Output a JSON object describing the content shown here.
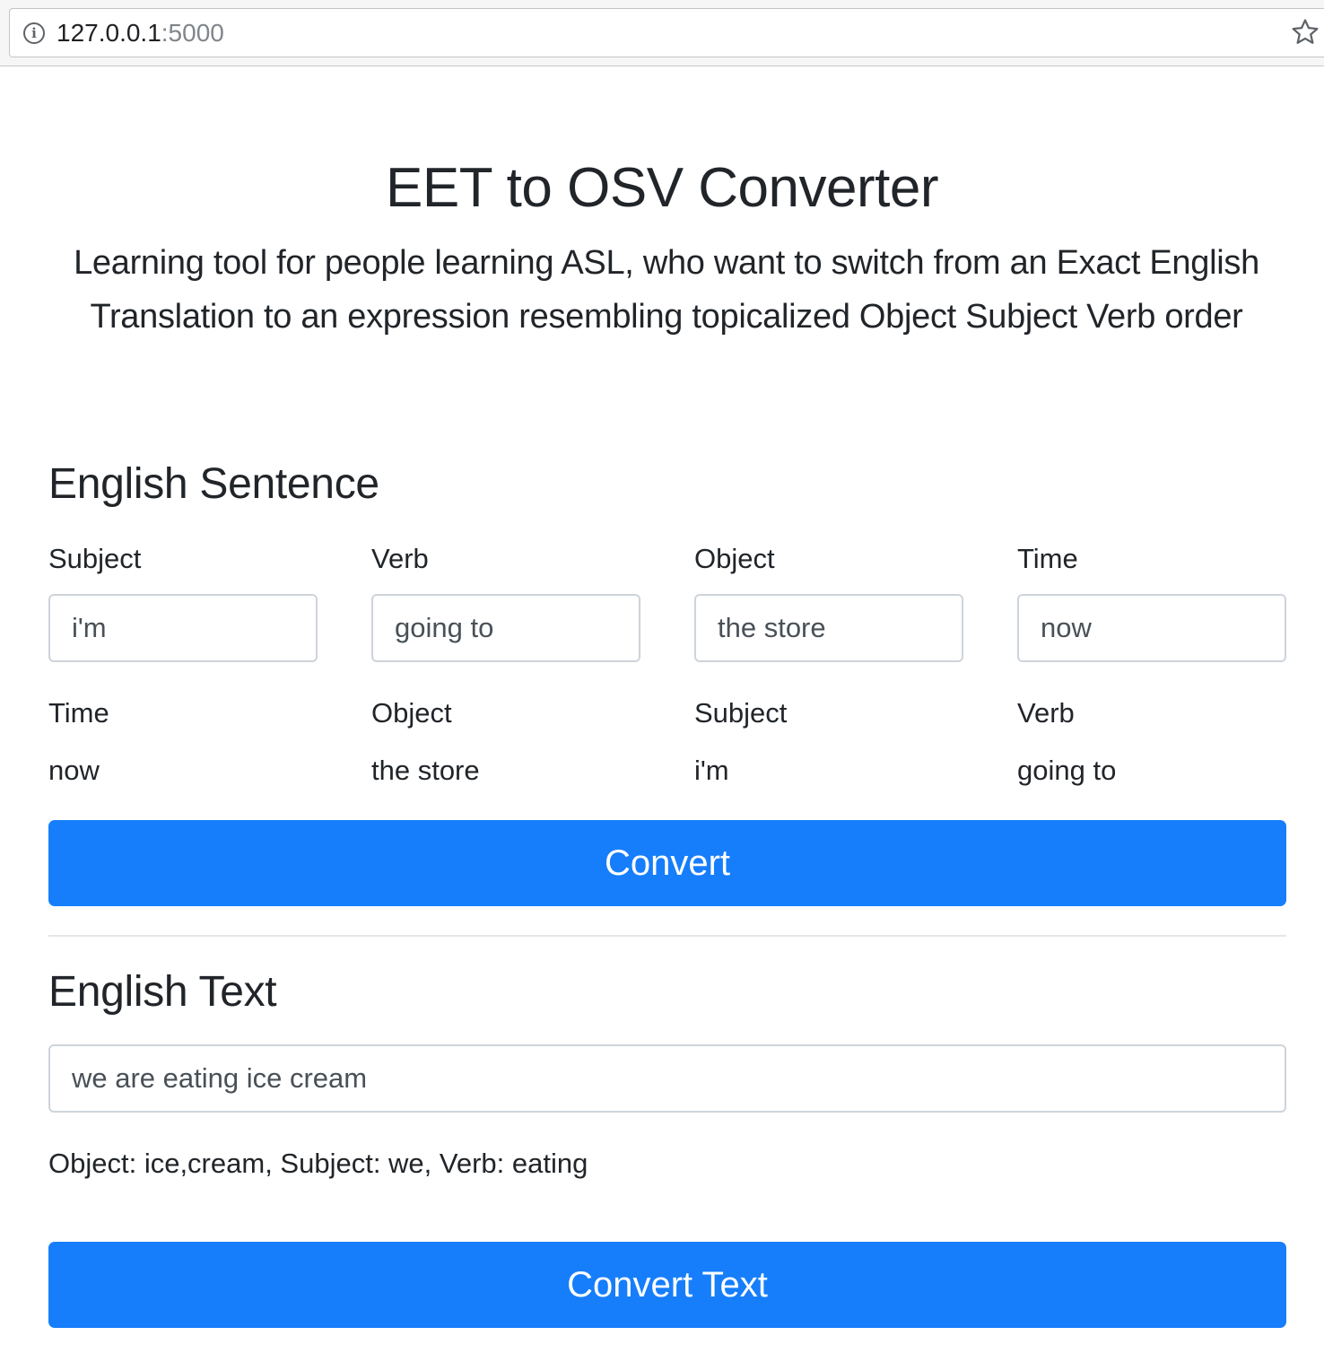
{
  "browser": {
    "url_host": "127.0.0.1",
    "url_port": ":5000"
  },
  "header": {
    "title": "EET to OSV Converter",
    "lead": "Learning tool for people learning ASL, who want to switch from an Exact English Translation to an expression resembling topicalized Object Subject Verb order"
  },
  "sentence_section": {
    "heading": "English Sentence",
    "inputs": [
      {
        "label": "Subject",
        "value": "i'm"
      },
      {
        "label": "Verb",
        "value": "going to"
      },
      {
        "label": "Object",
        "value": "the store"
      },
      {
        "label": "Time",
        "value": "now"
      }
    ],
    "outputs": [
      {
        "label": "Time",
        "value": "now"
      },
      {
        "label": "Object",
        "value": "the store"
      },
      {
        "label": "Subject",
        "value": "i'm"
      },
      {
        "label": "Verb",
        "value": "going to"
      }
    ],
    "button_label": "Convert"
  },
  "text_section": {
    "heading": "English Text",
    "input_value": "we are eating ice cream",
    "result": "Object: ice,cream, Subject: we, Verb: eating",
    "button_label": "Convert Text"
  },
  "colors": {
    "primary": "#167efb",
    "text": "#212529",
    "input_border": "#ced4da"
  }
}
